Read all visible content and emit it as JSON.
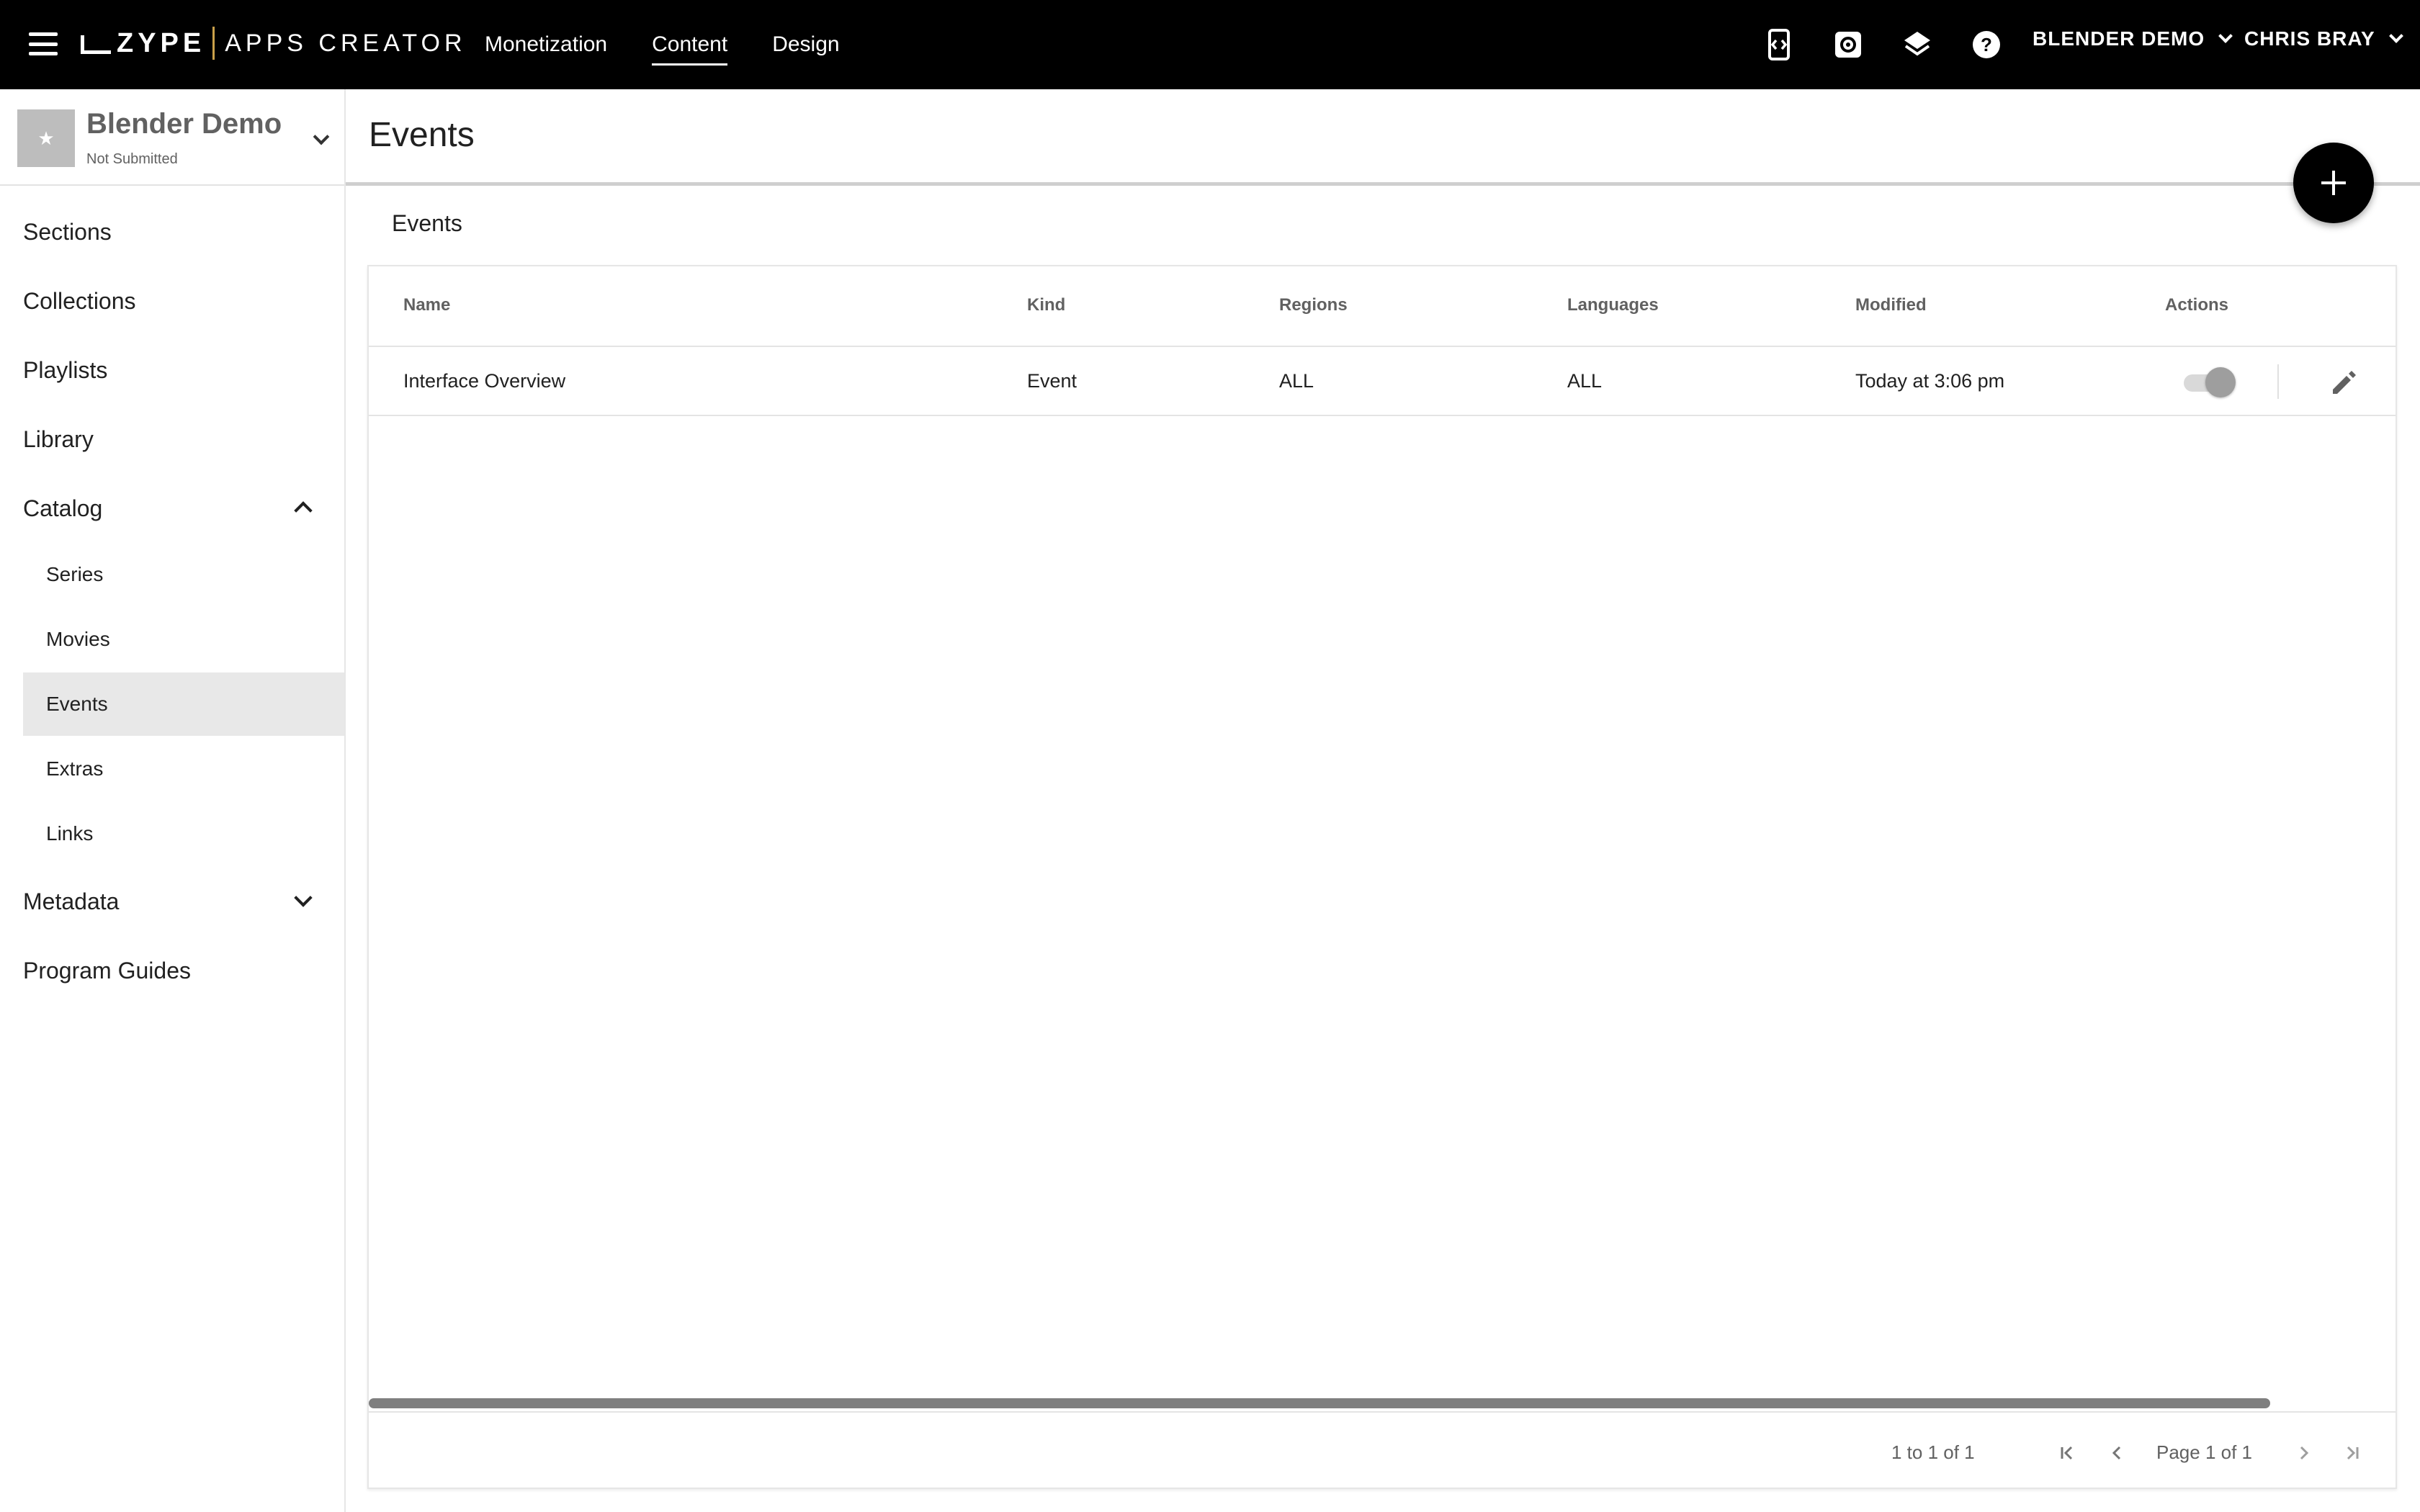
{
  "topbar": {
    "logo_brand": "ZYPE",
    "logo_product": "APPS CREATOR",
    "nav": [
      {
        "label": "Monetization"
      },
      {
        "label": "Content",
        "active": true
      },
      {
        "label": "Design"
      }
    ],
    "icons": [
      "app-preview-icon",
      "settings-icon",
      "layers-icon",
      "help-icon"
    ],
    "account_label": "BLENDER DEMO",
    "user_label": "CHRIS BRAY"
  },
  "sidebar": {
    "app_name": "Blender Demo",
    "app_status": "Not Submitted",
    "items": [
      {
        "label": "Sections"
      },
      {
        "label": "Collections"
      },
      {
        "label": "Playlists"
      },
      {
        "label": "Library"
      },
      {
        "label": "Catalog",
        "expanded": true
      },
      {
        "label": "Series"
      },
      {
        "label": "Movies"
      },
      {
        "label": "Events",
        "selected": true
      },
      {
        "label": "Extras"
      },
      {
        "label": "Links"
      },
      {
        "label": "Metadata",
        "expanded": false
      },
      {
        "label": "Program Guides"
      }
    ]
  },
  "main": {
    "title": "Events",
    "section_label": "Events",
    "table": {
      "columns": [
        "Name",
        "Kind",
        "Regions",
        "Languages",
        "Modified",
        "Actions"
      ],
      "rows": [
        {
          "name": "Interface Overview",
          "kind": "Event",
          "regions": "ALL",
          "languages": "ALL",
          "modified": "Today at 3:06 pm",
          "enabled": true
        }
      ]
    },
    "pagination": {
      "summary": "1 to 1 of 1",
      "page_label": "Page 1 of 1"
    }
  },
  "colors": {
    "topbar_bg": "#000000",
    "logo_accent": "#c9a04a",
    "selected_bg": "#e8e8e8",
    "fab_bg": "#000000"
  }
}
